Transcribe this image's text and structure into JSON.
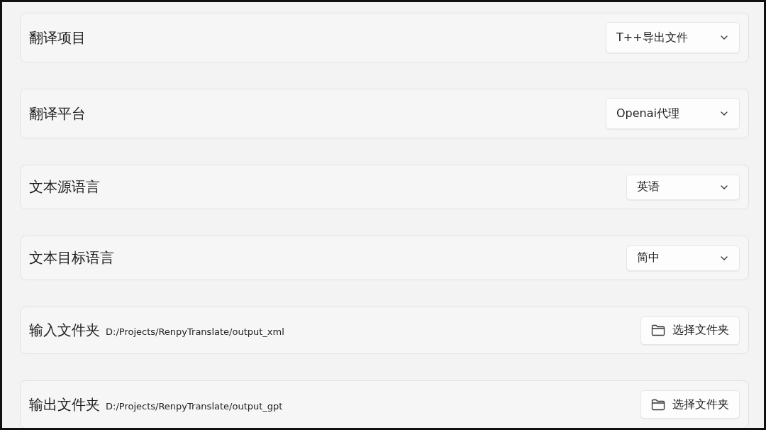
{
  "settings": [
    {
      "kind": "select",
      "label": "翻译项目",
      "value": "T++导出文件"
    },
    {
      "kind": "select",
      "label": "翻译平台",
      "value": "Openai代理"
    },
    {
      "kind": "select",
      "label": "文本源语言",
      "value": "英语"
    },
    {
      "kind": "select",
      "label": "文本目标语言",
      "value": "简中"
    },
    {
      "kind": "folder",
      "label": "输入文件夹",
      "path": "D:/Projects/RenpyTranslate/output_xml",
      "button": "选择文件夹"
    },
    {
      "kind": "folder",
      "label": "输出文件夹",
      "path": "D:/Projects/RenpyTranslate/output_gpt",
      "button": "选择文件夹"
    }
  ]
}
